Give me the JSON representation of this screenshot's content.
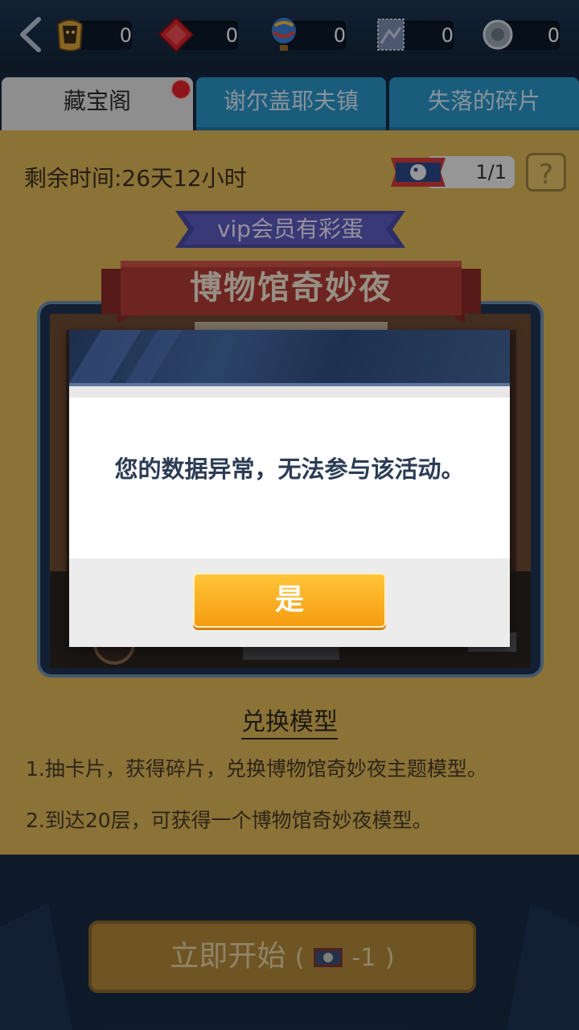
{
  "resources": [
    {
      "icon": "pharaoh-mask-icon",
      "value": "0"
    },
    {
      "icon": "red-gem-icon",
      "value": "0"
    },
    {
      "icon": "hot-air-balloon-icon",
      "value": "0"
    },
    {
      "icon": "stamp-card-icon",
      "value": "0"
    },
    {
      "icon": "silver-coin-icon",
      "value": "0"
    }
  ],
  "tabs": [
    {
      "label": "藏宝阁",
      "active": true,
      "has_notification": true
    },
    {
      "label": "谢尔盖耶夫镇",
      "active": false
    },
    {
      "label": "失落的碎片",
      "active": false
    }
  ],
  "event": {
    "time_remaining": "剩余时间:26天12小时",
    "ticket_count": "1/1",
    "help_label": "?",
    "vip_banner": "vip会员有彩蛋",
    "title": "博物馆奇妙夜"
  },
  "exchange": {
    "heading": "兑换模型",
    "rules": [
      "1.抽卡片，获得碎片，兑换博物馆奇妙夜主题模型。",
      "2.到达20层，可获得一个博物馆奇妙夜模型。"
    ]
  },
  "start_button": {
    "label": "立即开始",
    "paren_open": "(",
    "cost": "-1",
    "paren_close": ")"
  },
  "dialog": {
    "message": "您的数据异常，无法参与该活动。",
    "confirm_label": "是"
  },
  "colors": {
    "accent_orange": "#f5a51a",
    "panel_gold": "#e0b95a",
    "tab_blue": "#2a95c9",
    "navy": "#1a2a40"
  }
}
